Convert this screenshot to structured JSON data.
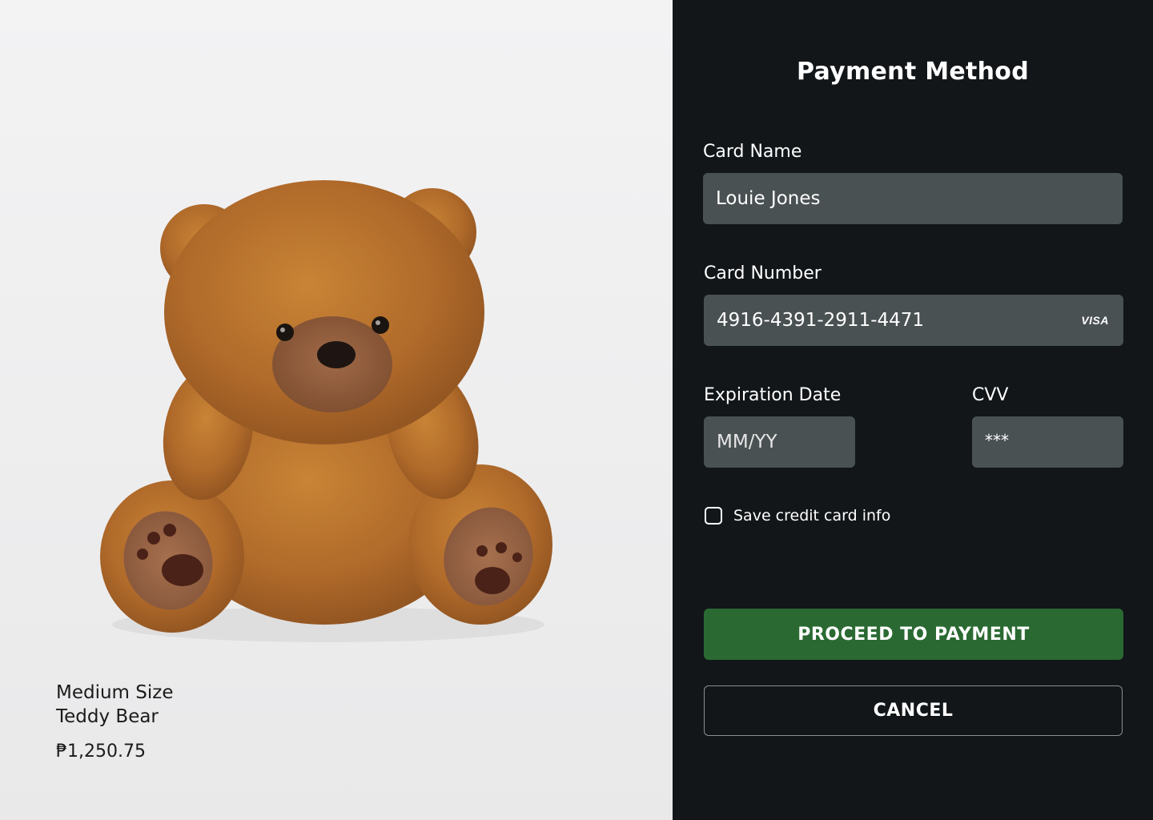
{
  "product": {
    "name_line1": "Medium Size",
    "name_line2": "Teddy Bear",
    "price": "₱1,250.75"
  },
  "payment": {
    "title": "Payment Method",
    "card_name": {
      "label": "Card Name",
      "value": "Louie Jones"
    },
    "card_number": {
      "label": "Card Number",
      "value": "4916-4391-2911-4471",
      "brand": "VISA"
    },
    "expiration": {
      "label": "Expiration Date",
      "placeholder": "MM/YY"
    },
    "cvv": {
      "label": "CVV",
      "value": "***"
    },
    "save_info": {
      "label": "Save credit card info",
      "checked": false
    },
    "proceed_label": "PROCEED TO PAYMENT",
    "cancel_label": "CANCEL"
  },
  "colors": {
    "panel_bg": "#121619",
    "input_bg": "#4a5153",
    "proceed_bg": "#2a6a32",
    "bear_fur": "#b06a2a"
  }
}
